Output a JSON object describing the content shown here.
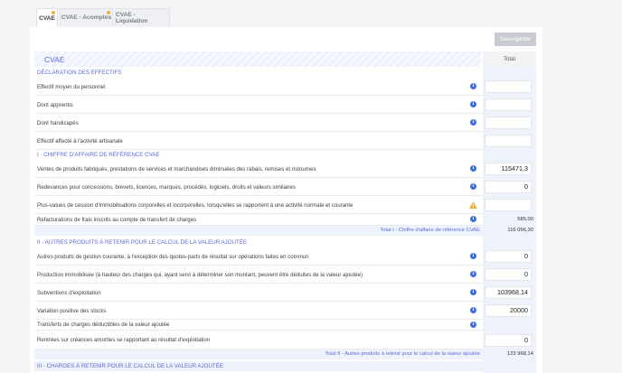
{
  "tabs": [
    {
      "label": "CVAE",
      "active": true,
      "badge": true
    },
    {
      "label": "CVAE - Acomptes",
      "active": false,
      "badge": true
    },
    {
      "label": "CVAE - Liquidation",
      "active": false,
      "badge": false
    }
  ],
  "toolbar": {
    "save_label": "Sauvegarder"
  },
  "header": {
    "title": "CVAE",
    "total_column": "Total"
  },
  "sections": {
    "effectifs": "DÉCLARATION DES EFFECTIFS",
    "ca": "I - CHIFFRE D'AFFAIRE DE RÉFÉRENCE CVAE",
    "autres": "II - AUTRES PRODUITS À RETENIR POUR LE CALCUL DE LA VALEUR AJOUTÉE",
    "charges": "III - CHARGES À RETENIR POUR LE CALCUL DE LA VALEUR AJOUTÉE"
  },
  "rows": [
    {
      "label": "Effectif moyen du personnel",
      "icon": "info-icon",
      "value": ""
    },
    {
      "label": "Dont apprentis",
      "icon": "info-icon",
      "value": ""
    },
    {
      "label": "Dont handicapés",
      "icon": "info-icon",
      "value": ""
    },
    {
      "label": "Effectif affecté à l'activité artisanale",
      "icon": "",
      "value": ""
    },
    {
      "label": "Ventes de produits fabriqués, prestations de services et marchandises diminuées des rabais, remises et ristournes",
      "icon": "info-icon",
      "value": "115471,3"
    },
    {
      "label": "Redevances pour concessions, brevets, licences, marques, procédés, logiciels, droits et valeurs similaires",
      "icon": "info-icon",
      "value": "0"
    },
    {
      "label": "Plus-values de cession d'immobilisations corporelles et incorporelles, lorsqu'elles se rapportent à une activité normale et courante",
      "icon": "warning-icon",
      "value": ""
    },
    {
      "label": "Refacturations de frais inscrits au compte de transfert de charges",
      "icon": "info-icon",
      "value": "585,00"
    },
    {
      "label": "Autres produits de gestion courante, à l'exception des quotes-parts de résultat sur opérations faites en commun",
      "icon": "info-icon",
      "value": "0"
    },
    {
      "label": "Production immobilisée (à hauteur des charges qui, ayant servi à déterminer son montant, peuvent être déduites de la valeur ajoutée)",
      "icon": "info-icon",
      "value": "0"
    },
    {
      "label": "Subventions d'exploitation",
      "icon": "info-icon",
      "value": "103968,14"
    },
    {
      "label": "Variation positive des stocks",
      "icon": "info-icon",
      "value": "20000"
    },
    {
      "label": "Transferts de charges déductibles de la valeur ajoutée",
      "icon": "info-icon",
      "value": ""
    },
    {
      "label": "Rentrées sur créances amorties se rapportant au résultat d'exploitation",
      "icon": "",
      "value": "0"
    }
  ],
  "totals": {
    "total1_label": "Total I - Chiffre d'affaire de référence CVAE",
    "total1_value": "116 056,30",
    "total2_label": "Total II - Autres produits à retenir pour le calcul de la valeur ajoutée",
    "total2_value": "123 968,14"
  },
  "colors": {
    "accent": "#5b6bd8",
    "info": "#3d6fd8",
    "warning": "#f0b03a",
    "band": "#eef2fb"
  }
}
